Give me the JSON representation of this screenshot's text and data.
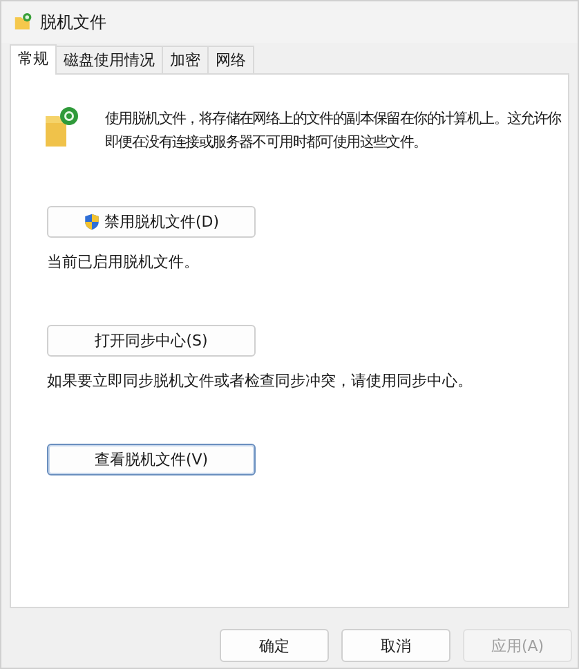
{
  "window": {
    "title": "脱机文件"
  },
  "tabs": [
    {
      "label": "常规",
      "selected": true
    },
    {
      "label": "磁盘使用情况",
      "selected": false
    },
    {
      "label": "加密",
      "selected": false
    },
    {
      "label": "网络",
      "selected": false
    }
  ],
  "description": "使用脱机文件，将存储在网络上的文件的副本保留在你的计算机上。这允许你即便在没有连接或服务器不可用时都可使用这些文件。",
  "sections": [
    {
      "button": {
        "label": "禁用脱机文件(D)",
        "shield": true,
        "focused": false
      },
      "note": "当前已启用脱机文件。"
    },
    {
      "button": {
        "label": "打开同步中心(S)",
        "shield": false,
        "focused": false
      },
      "note": "如果要立即同步脱机文件或者检查同步冲突，请使用同步中心。"
    },
    {
      "button": {
        "label": "查看脱机文件(V)",
        "shield": false,
        "focused": true
      }
    }
  ],
  "footer": [
    {
      "label": "确定",
      "disabled": false
    },
    {
      "label": "取消",
      "disabled": false
    },
    {
      "label": "应用(A)",
      "disabled": true
    }
  ]
}
